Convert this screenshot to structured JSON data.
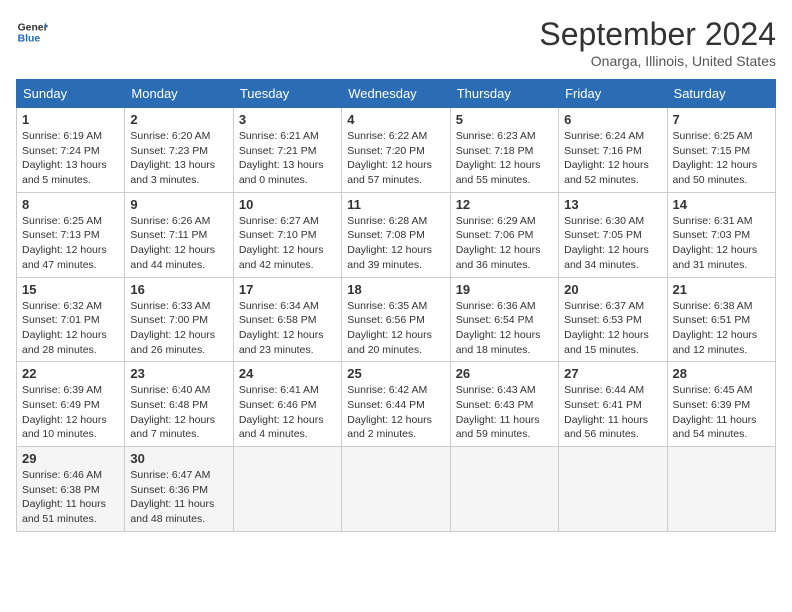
{
  "header": {
    "logo_line1": "General",
    "logo_line2": "Blue",
    "month_title": "September 2024",
    "location": "Onarga, Illinois, United States"
  },
  "weekdays": [
    "Sunday",
    "Monday",
    "Tuesday",
    "Wednesday",
    "Thursday",
    "Friday",
    "Saturday"
  ],
  "weeks": [
    [
      {
        "day": "1",
        "sunrise": "6:19 AM",
        "sunset": "7:24 PM",
        "daylight": "13 hours and 5 minutes."
      },
      {
        "day": "2",
        "sunrise": "6:20 AM",
        "sunset": "7:23 PM",
        "daylight": "13 hours and 3 minutes."
      },
      {
        "day": "3",
        "sunrise": "6:21 AM",
        "sunset": "7:21 PM",
        "daylight": "13 hours and 0 minutes."
      },
      {
        "day": "4",
        "sunrise": "6:22 AM",
        "sunset": "7:20 PM",
        "daylight": "12 hours and 57 minutes."
      },
      {
        "day": "5",
        "sunrise": "6:23 AM",
        "sunset": "7:18 PM",
        "daylight": "12 hours and 55 minutes."
      },
      {
        "day": "6",
        "sunrise": "6:24 AM",
        "sunset": "7:16 PM",
        "daylight": "12 hours and 52 minutes."
      },
      {
        "day": "7",
        "sunrise": "6:25 AM",
        "sunset": "7:15 PM",
        "daylight": "12 hours and 50 minutes."
      }
    ],
    [
      {
        "day": "8",
        "sunrise": "6:25 AM",
        "sunset": "7:13 PM",
        "daylight": "12 hours and 47 minutes."
      },
      {
        "day": "9",
        "sunrise": "6:26 AM",
        "sunset": "7:11 PM",
        "daylight": "12 hours and 44 minutes."
      },
      {
        "day": "10",
        "sunrise": "6:27 AM",
        "sunset": "7:10 PM",
        "daylight": "12 hours and 42 minutes."
      },
      {
        "day": "11",
        "sunrise": "6:28 AM",
        "sunset": "7:08 PM",
        "daylight": "12 hours and 39 minutes."
      },
      {
        "day": "12",
        "sunrise": "6:29 AM",
        "sunset": "7:06 PM",
        "daylight": "12 hours and 36 minutes."
      },
      {
        "day": "13",
        "sunrise": "6:30 AM",
        "sunset": "7:05 PM",
        "daylight": "12 hours and 34 minutes."
      },
      {
        "day": "14",
        "sunrise": "6:31 AM",
        "sunset": "7:03 PM",
        "daylight": "12 hours and 31 minutes."
      }
    ],
    [
      {
        "day": "15",
        "sunrise": "6:32 AM",
        "sunset": "7:01 PM",
        "daylight": "12 hours and 28 minutes."
      },
      {
        "day": "16",
        "sunrise": "6:33 AM",
        "sunset": "7:00 PM",
        "daylight": "12 hours and 26 minutes."
      },
      {
        "day": "17",
        "sunrise": "6:34 AM",
        "sunset": "6:58 PM",
        "daylight": "12 hours and 23 minutes."
      },
      {
        "day": "18",
        "sunrise": "6:35 AM",
        "sunset": "6:56 PM",
        "daylight": "12 hours and 20 minutes."
      },
      {
        "day": "19",
        "sunrise": "6:36 AM",
        "sunset": "6:54 PM",
        "daylight": "12 hours and 18 minutes."
      },
      {
        "day": "20",
        "sunrise": "6:37 AM",
        "sunset": "6:53 PM",
        "daylight": "12 hours and 15 minutes."
      },
      {
        "day": "21",
        "sunrise": "6:38 AM",
        "sunset": "6:51 PM",
        "daylight": "12 hours and 12 minutes."
      }
    ],
    [
      {
        "day": "22",
        "sunrise": "6:39 AM",
        "sunset": "6:49 PM",
        "daylight": "12 hours and 10 minutes."
      },
      {
        "day": "23",
        "sunrise": "6:40 AM",
        "sunset": "6:48 PM",
        "daylight": "12 hours and 7 minutes."
      },
      {
        "day": "24",
        "sunrise": "6:41 AM",
        "sunset": "6:46 PM",
        "daylight": "12 hours and 4 minutes."
      },
      {
        "day": "25",
        "sunrise": "6:42 AM",
        "sunset": "6:44 PM",
        "daylight": "12 hours and 2 minutes."
      },
      {
        "day": "26",
        "sunrise": "6:43 AM",
        "sunset": "6:43 PM",
        "daylight": "11 hours and 59 minutes."
      },
      {
        "day": "27",
        "sunrise": "6:44 AM",
        "sunset": "6:41 PM",
        "daylight": "11 hours and 56 minutes."
      },
      {
        "day": "28",
        "sunrise": "6:45 AM",
        "sunset": "6:39 PM",
        "daylight": "11 hours and 54 minutes."
      }
    ],
    [
      {
        "day": "29",
        "sunrise": "6:46 AM",
        "sunset": "6:38 PM",
        "daylight": "11 hours and 51 minutes."
      },
      {
        "day": "30",
        "sunrise": "6:47 AM",
        "sunset": "6:36 PM",
        "daylight": "11 hours and 48 minutes."
      },
      null,
      null,
      null,
      null,
      null
    ]
  ]
}
